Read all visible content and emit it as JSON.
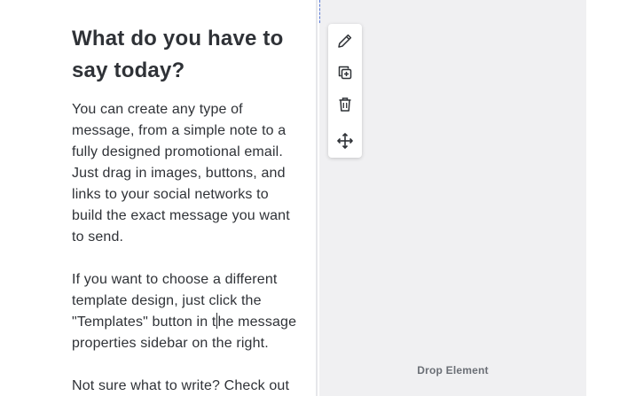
{
  "content": {
    "heading": "What do you have to say today?",
    "paragraph1": "You can create any type of\nmessage, from a simple note to a\nfully designed promotional email.\nJust drag in images, buttons, and\nlinks to your social networks to\nbuild the exact message you want\nto send.",
    "paragraph2_before_caret": "If you want to choose a different\ntemplate design, just click the\n\"Templates\" button in t",
    "paragraph2_after_caret": "he message\nproperties sidebar on the right.",
    "paragraph3": "Not sure what to write? Check out"
  },
  "toolbar": {
    "items": [
      {
        "icon": "pencil-icon",
        "action": "edit"
      },
      {
        "icon": "duplicate-icon",
        "action": "duplicate"
      },
      {
        "icon": "trash-icon",
        "action": "delete"
      },
      {
        "icon": "move-icon",
        "action": "move"
      }
    ]
  },
  "drop_zone": {
    "label": "Drop Element"
  },
  "colors": {
    "text": "#2f3237",
    "drop_zone_bg": "#f0f0f2",
    "guide": "#5b7bd5",
    "icon": "#2f3237",
    "drop_label": "#6b6f76"
  }
}
